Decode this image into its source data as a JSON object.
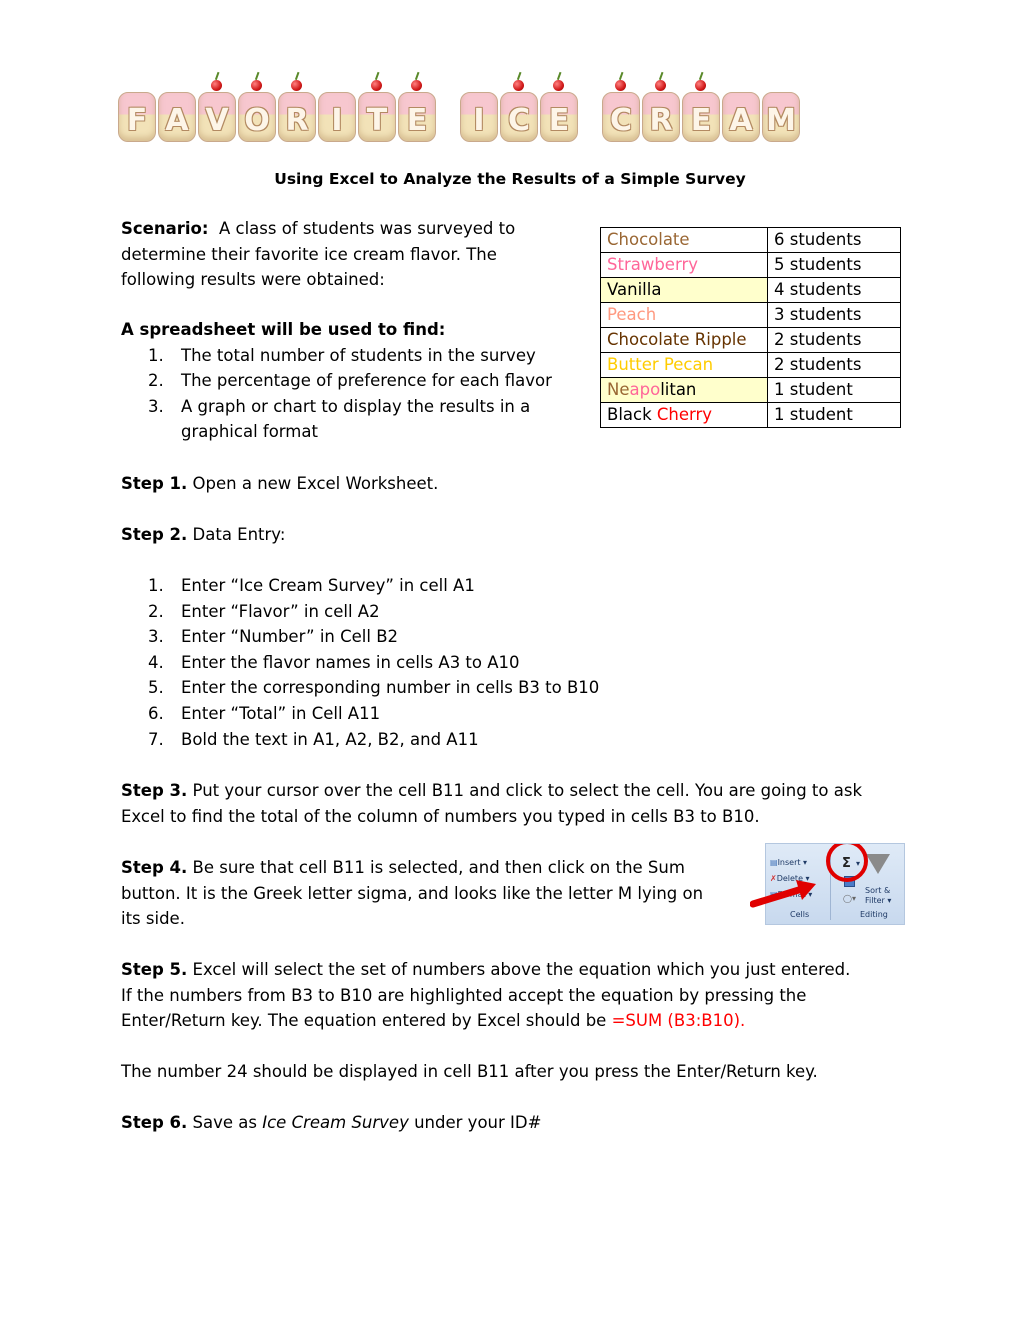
{
  "banner": {
    "title": "Favorite Ice Cream",
    "letters": [
      "F",
      "A",
      "V",
      "O",
      "R",
      "I",
      "T",
      "E",
      " ",
      "I",
      "C",
      "E",
      " ",
      "C",
      "R",
      "E",
      "A",
      "M"
    ]
  },
  "subtitle": "Using Excel to Analyze the Results of a Simple Survey",
  "scenario": {
    "label": "Scenario:",
    "line1": "A class of students was surveyed to",
    "line2": "determine their favorite ice cream flavor.  The",
    "line3": "following results were obtained:"
  },
  "goals": {
    "heading": "A spreadsheet will be used to find:",
    "items": [
      {
        "num": "1.",
        "text": "The total number of students in the survey"
      },
      {
        "num": "2.",
        "text": "The percentage of preference for each flavor"
      },
      {
        "num": "3.",
        "text": "A graph or chart to display the results in a"
      },
      {
        "num": "",
        "text": "graphical format"
      }
    ]
  },
  "table": {
    "rows": [
      {
        "flavor": "Chocolate",
        "count": "6 students",
        "color": "#996633"
      },
      {
        "flavor": "Strawberry",
        "count": "5 students",
        "color": "#ff6699"
      },
      {
        "flavor": "Vanilla",
        "count": "4 students",
        "color": "#000000",
        "highlight": "#ffffcc"
      },
      {
        "flavor": "Peach",
        "count": "3 students",
        "color": "#ff9980"
      },
      {
        "flavor": "Chocolate Ripple",
        "count": "2 students",
        "color": "#663300"
      },
      {
        "flavor": "Butter Pecan",
        "count": "2 students",
        "color": "#ffcc00"
      },
      {
        "flavor_parts": [
          "Ne",
          "apo",
          "litan"
        ],
        "count": "1  student",
        "part_colors": [
          "#996633",
          "#ff6699",
          "#000000"
        ],
        "highlight": "#ffffcc"
      },
      {
        "flavor_parts": [
          "Black ",
          "Cherry"
        ],
        "count": "1  student",
        "part_colors": [
          "#000000",
          "#ff0000"
        ]
      }
    ]
  },
  "step1": {
    "label": "Step 1.",
    "text": "Open a new Excel Worksheet."
  },
  "step2": {
    "label": "Step 2.",
    "text": "Data Entry:",
    "items": [
      {
        "num": "1.",
        "text": "Enter “Ice Cream Survey” in cell A1"
      },
      {
        "num": "2.",
        "text": "Enter “Flavor” in cell A2"
      },
      {
        "num": "3.",
        "text": "Enter “Number” in Cell B2"
      },
      {
        "num": "4.",
        "text": "Enter the flavor names in cells A3 to A10"
      },
      {
        "num": "5.",
        "text": "Enter the corresponding number in cells B3 to B10"
      },
      {
        "num": "6.",
        "text": "Enter “Total” in Cell A11"
      },
      {
        "num": "7.",
        "text": "Bold the text in A1, A2, B2, and A11"
      }
    ]
  },
  "step3": {
    "label": "Step 3.",
    "line1": "Put your cursor over the cell B11 and click to select the cell. You are going to ask",
    "line2": "Excel to find the total of the column of numbers you typed in cells B3 to B10."
  },
  "step4": {
    "label": "Step 4.",
    "line1": " Be sure that cell B11 is selected, and then click on the Sum",
    "line2": "button.  It is the Greek letter sigma, and looks like the letter M lying on",
    "line3": "its side."
  },
  "ribbon": {
    "insert": "Insert",
    "delete": "Delete",
    "format": "Format",
    "cells": "Cells",
    "sigma": "Σ",
    "sort": "Sort &",
    "filter": "Filter",
    "editing": "Editing"
  },
  "step5": {
    "label": "Step 5.",
    "line1": "Excel will select the set of numbers above the equation which you just entered.",
    "line2": "If the numbers from B3 to B10 are highlighted accept the equation by pressing the",
    "line3": "Enter/Return key. The equation entered by Excel should be ",
    "formula": "=SUM (B3:B10)."
  },
  "result_line": "The number 24 should be displayed in cell B11 after you press the Enter/Return key.",
  "step6": {
    "label": "Step 6.",
    "pre": "Save as ",
    "italic": "Ice Cream Survey",
    "post": " under your ID#"
  }
}
